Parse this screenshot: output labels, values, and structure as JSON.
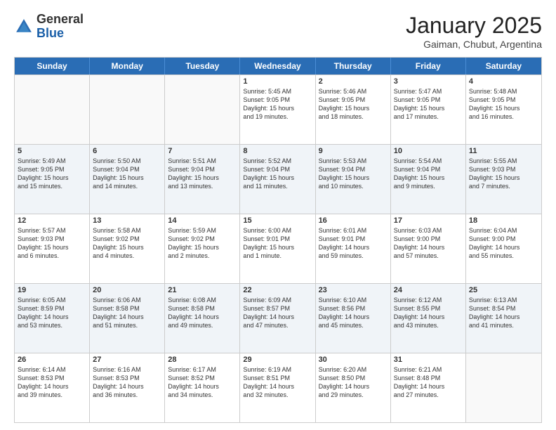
{
  "logo": {
    "general": "General",
    "blue": "Blue"
  },
  "header": {
    "title": "January 2025",
    "subtitle": "Gaiman, Chubut, Argentina"
  },
  "days": [
    "Sunday",
    "Monday",
    "Tuesday",
    "Wednesday",
    "Thursday",
    "Friday",
    "Saturday"
  ],
  "rows": [
    [
      {
        "day": "",
        "text": "",
        "empty": true
      },
      {
        "day": "",
        "text": "",
        "empty": true
      },
      {
        "day": "",
        "text": "",
        "empty": true
      },
      {
        "day": "1",
        "text": "Sunrise: 5:45 AM\nSunset: 9:05 PM\nDaylight: 15 hours\nand 19 minutes.",
        "empty": false
      },
      {
        "day": "2",
        "text": "Sunrise: 5:46 AM\nSunset: 9:05 PM\nDaylight: 15 hours\nand 18 minutes.",
        "empty": false
      },
      {
        "day": "3",
        "text": "Sunrise: 5:47 AM\nSunset: 9:05 PM\nDaylight: 15 hours\nand 17 minutes.",
        "empty": false
      },
      {
        "day": "4",
        "text": "Sunrise: 5:48 AM\nSunset: 9:05 PM\nDaylight: 15 hours\nand 16 minutes.",
        "empty": false
      }
    ],
    [
      {
        "day": "5",
        "text": "Sunrise: 5:49 AM\nSunset: 9:05 PM\nDaylight: 15 hours\nand 15 minutes.",
        "empty": false
      },
      {
        "day": "6",
        "text": "Sunrise: 5:50 AM\nSunset: 9:04 PM\nDaylight: 15 hours\nand 14 minutes.",
        "empty": false
      },
      {
        "day": "7",
        "text": "Sunrise: 5:51 AM\nSunset: 9:04 PM\nDaylight: 15 hours\nand 13 minutes.",
        "empty": false
      },
      {
        "day": "8",
        "text": "Sunrise: 5:52 AM\nSunset: 9:04 PM\nDaylight: 15 hours\nand 11 minutes.",
        "empty": false
      },
      {
        "day": "9",
        "text": "Sunrise: 5:53 AM\nSunset: 9:04 PM\nDaylight: 15 hours\nand 10 minutes.",
        "empty": false
      },
      {
        "day": "10",
        "text": "Sunrise: 5:54 AM\nSunset: 9:04 PM\nDaylight: 15 hours\nand 9 minutes.",
        "empty": false
      },
      {
        "day": "11",
        "text": "Sunrise: 5:55 AM\nSunset: 9:03 PM\nDaylight: 15 hours\nand 7 minutes.",
        "empty": false
      }
    ],
    [
      {
        "day": "12",
        "text": "Sunrise: 5:57 AM\nSunset: 9:03 PM\nDaylight: 15 hours\nand 6 minutes.",
        "empty": false
      },
      {
        "day": "13",
        "text": "Sunrise: 5:58 AM\nSunset: 9:02 PM\nDaylight: 15 hours\nand 4 minutes.",
        "empty": false
      },
      {
        "day": "14",
        "text": "Sunrise: 5:59 AM\nSunset: 9:02 PM\nDaylight: 15 hours\nand 2 minutes.",
        "empty": false
      },
      {
        "day": "15",
        "text": "Sunrise: 6:00 AM\nSunset: 9:01 PM\nDaylight: 15 hours\nand 1 minute.",
        "empty": false
      },
      {
        "day": "16",
        "text": "Sunrise: 6:01 AM\nSunset: 9:01 PM\nDaylight: 14 hours\nand 59 minutes.",
        "empty": false
      },
      {
        "day": "17",
        "text": "Sunrise: 6:03 AM\nSunset: 9:00 PM\nDaylight: 14 hours\nand 57 minutes.",
        "empty": false
      },
      {
        "day": "18",
        "text": "Sunrise: 6:04 AM\nSunset: 9:00 PM\nDaylight: 14 hours\nand 55 minutes.",
        "empty": false
      }
    ],
    [
      {
        "day": "19",
        "text": "Sunrise: 6:05 AM\nSunset: 8:59 PM\nDaylight: 14 hours\nand 53 minutes.",
        "empty": false
      },
      {
        "day": "20",
        "text": "Sunrise: 6:06 AM\nSunset: 8:58 PM\nDaylight: 14 hours\nand 51 minutes.",
        "empty": false
      },
      {
        "day": "21",
        "text": "Sunrise: 6:08 AM\nSunset: 8:58 PM\nDaylight: 14 hours\nand 49 minutes.",
        "empty": false
      },
      {
        "day": "22",
        "text": "Sunrise: 6:09 AM\nSunset: 8:57 PM\nDaylight: 14 hours\nand 47 minutes.",
        "empty": false
      },
      {
        "day": "23",
        "text": "Sunrise: 6:10 AM\nSunset: 8:56 PM\nDaylight: 14 hours\nand 45 minutes.",
        "empty": false
      },
      {
        "day": "24",
        "text": "Sunrise: 6:12 AM\nSunset: 8:55 PM\nDaylight: 14 hours\nand 43 minutes.",
        "empty": false
      },
      {
        "day": "25",
        "text": "Sunrise: 6:13 AM\nSunset: 8:54 PM\nDaylight: 14 hours\nand 41 minutes.",
        "empty": false
      }
    ],
    [
      {
        "day": "26",
        "text": "Sunrise: 6:14 AM\nSunset: 8:53 PM\nDaylight: 14 hours\nand 39 minutes.",
        "empty": false
      },
      {
        "day": "27",
        "text": "Sunrise: 6:16 AM\nSunset: 8:53 PM\nDaylight: 14 hours\nand 36 minutes.",
        "empty": false
      },
      {
        "day": "28",
        "text": "Sunrise: 6:17 AM\nSunset: 8:52 PM\nDaylight: 14 hours\nand 34 minutes.",
        "empty": false
      },
      {
        "day": "29",
        "text": "Sunrise: 6:19 AM\nSunset: 8:51 PM\nDaylight: 14 hours\nand 32 minutes.",
        "empty": false
      },
      {
        "day": "30",
        "text": "Sunrise: 6:20 AM\nSunset: 8:50 PM\nDaylight: 14 hours\nand 29 minutes.",
        "empty": false
      },
      {
        "day": "31",
        "text": "Sunrise: 6:21 AM\nSunset: 8:48 PM\nDaylight: 14 hours\nand 27 minutes.",
        "empty": false
      },
      {
        "day": "",
        "text": "",
        "empty": true
      }
    ]
  ]
}
